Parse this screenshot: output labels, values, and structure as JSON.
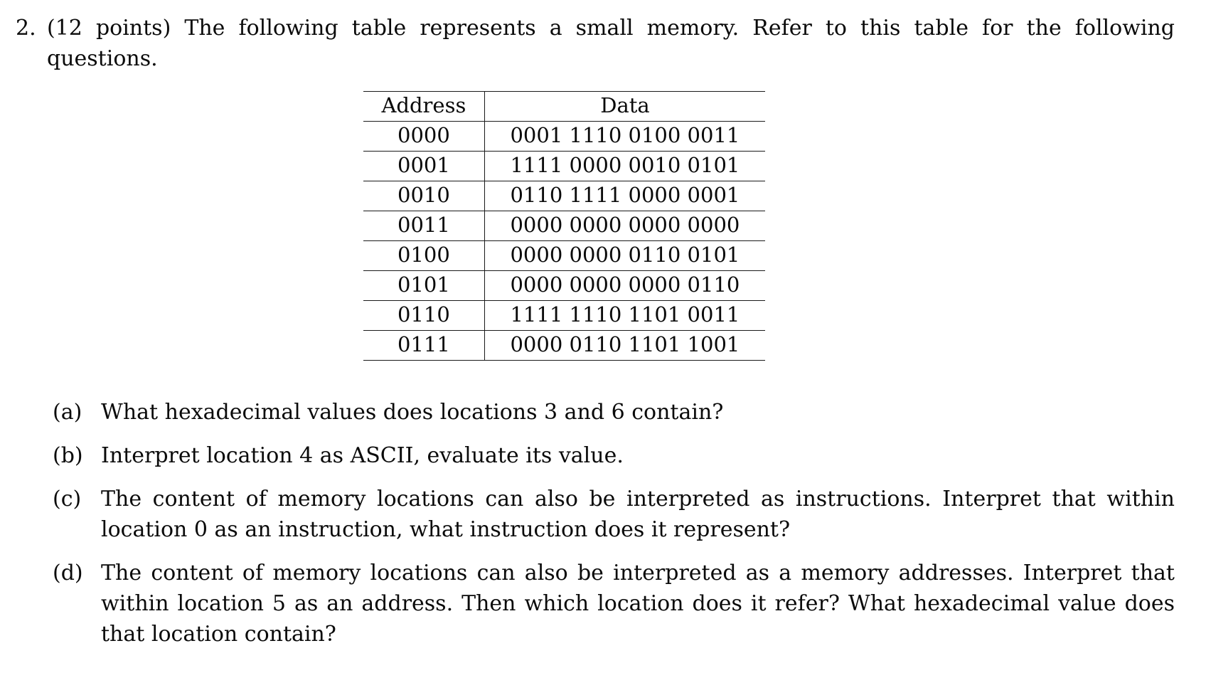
{
  "problem": {
    "number": "2.",
    "text": "(12 points) The following table represents a small memory.  Refer to this table for the following questions."
  },
  "memory_table": {
    "headers": [
      "Address",
      "Data"
    ],
    "rows": [
      {
        "address": "0000",
        "data": "0001 1110 0100 0011"
      },
      {
        "address": "0001",
        "data": "1111 0000 0010 0101"
      },
      {
        "address": "0010",
        "data": "0110 1111 0000 0001"
      },
      {
        "address": "0011",
        "data": "0000 0000 0000 0000"
      },
      {
        "address": "0100",
        "data": "0000 0000 0110 0101"
      },
      {
        "address": "0101",
        "data": "0000 0000 0000 0110"
      },
      {
        "address": "0110",
        "data": "1111 1110 1101 0011"
      },
      {
        "address": "0111",
        "data": "0000 0110 1101 1001"
      }
    ]
  },
  "subquestions": [
    {
      "label": "(a)",
      "text": "What hexadecimal values does locations 3 and 6 contain?"
    },
    {
      "label": "(b)",
      "text": "Interpret location 4 as ASCII, evaluate its value."
    },
    {
      "label": "(c)",
      "text": "The content of memory locations can also be interpreted as instructions.  Interpret that within location 0 as an instruction, what instruction does it represent?"
    },
    {
      "label": "(d)",
      "text": "The content of memory locations can also be interpreted as a memory addresses.  Interpret that within location 5 as an address.  Then which location does it refer?  What hexadecimal value does that location contain?"
    }
  ]
}
